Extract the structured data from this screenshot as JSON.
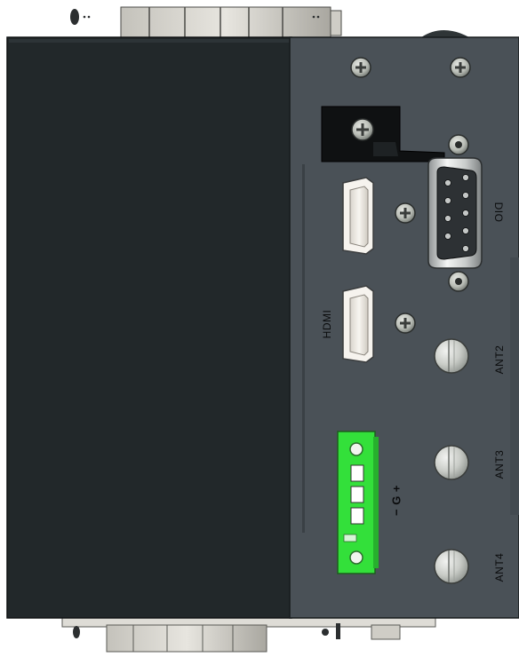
{
  "labels": {
    "hdmi": "HDMI",
    "dio": "DIO",
    "ant2": "ANT2",
    "ant3": "ANT3",
    "ant4": "ANT4",
    "power_polarity": "− G +"
  },
  "colors": {
    "enclosure_body": "#22282a",
    "io_panel": "#4a5157",
    "terminal_block": "#33e03a"
  },
  "icons": [
    "screw-icon",
    "hdmi-port-icon",
    "db9-port-icon",
    "antenna-connector-icon",
    "terminal-block-icon"
  ]
}
